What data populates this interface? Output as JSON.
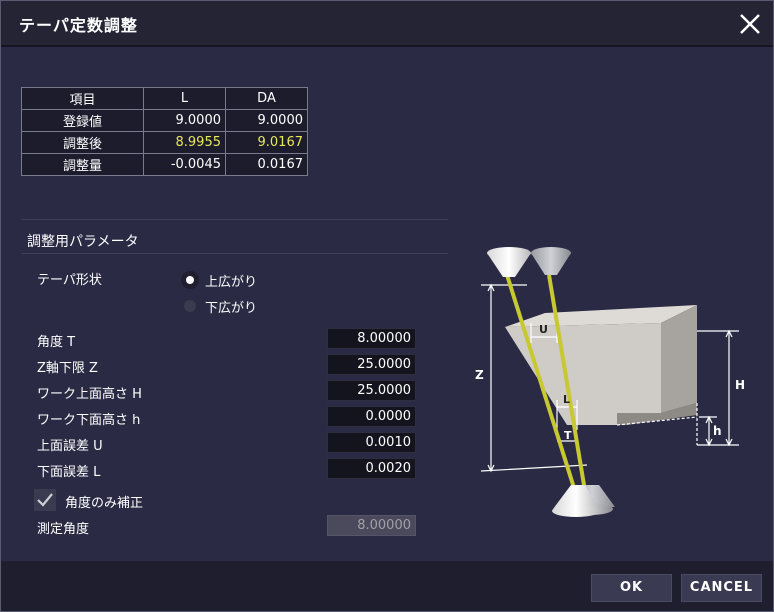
{
  "window": {
    "title": "テーパ定数調整"
  },
  "summary": {
    "headers": [
      "項目",
      "L",
      "DA"
    ],
    "rows": [
      {
        "label": "登録値",
        "l": "9.0000",
        "da": "9.0000"
      },
      {
        "label": "調整後",
        "l": "8.9955",
        "da": "9.0167"
      },
      {
        "label": "調整量",
        "l": "-0.0045",
        "da": "0.0167"
      }
    ],
    "highlight_color": "#e8e85a"
  },
  "params": {
    "section_title": "調整用パラメータ",
    "taper_shape_label": "テーパ形状",
    "shape_options": [
      "上広がり",
      "下広がり"
    ],
    "shape_selected": "上広がり",
    "angle_label": "角度  T",
    "angle_value": "8.00000",
    "z_limit_label": " Z軸下限   Z",
    "z_limit_value": "25.0000",
    "work_top_label": "ワーク上面高さ  H",
    "work_top_value": "25.0000",
    "work_bottom_label": "ワーク下面高さ  h",
    "work_bottom_value": "0.0000",
    "top_error_label": "上面誤差  U",
    "top_error_value": "0.0010",
    "bottom_error_label": "下面誤差  L",
    "bottom_error_value": "0.0020",
    "angle_only_label": "角度のみ補正",
    "angle_only_checked": true,
    "measured_angle_label": "測定角度",
    "measured_angle_value": "8.00000"
  },
  "diagram": {
    "labels": {
      "z": "Z",
      "u": "U",
      "l": "L",
      "t": "T",
      "h_upper": "H",
      "h_lower": "h"
    },
    "wire_color": "#c8c830"
  },
  "buttons": {
    "ok": "OK",
    "cancel": "CANCEL"
  }
}
